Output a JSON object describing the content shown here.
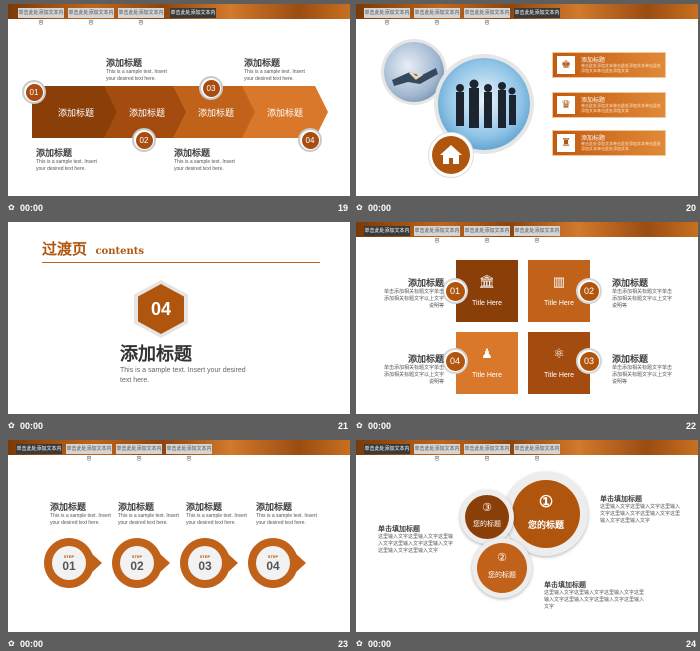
{
  "top_tabs": [
    "单击此处添加文本内容",
    "单击此处添加文本内容",
    "单击此处添加文本内容",
    "单击此处添加文本内容"
  ],
  "bottom_time": "00:00",
  "clock_icon": "clock-icon",
  "slides": {
    "s19": {
      "number": "19",
      "chevrons": [
        "添加标题",
        "添加标题",
        "添加标题",
        "添加标题"
      ],
      "markers": [
        "01",
        "02",
        "03",
        "04"
      ],
      "caption_title": "添加标题",
      "caption_text": "This is a sample text. Insert your desired text here."
    },
    "s20": {
      "number": "20",
      "boxes": [
        {
          "title": "添加标题",
          "text": "单击此处添加文本单击此处添加文本单击此处添加文本单击此处添加文本"
        },
        {
          "title": "添加标题",
          "text": "单击此处添加文本单击此处添加文本单击此处添加文本单击此处添加文本"
        },
        {
          "title": "添加标题",
          "text": "单击此处添加文本单击此处添加文本单击此处添加文本单击此处添加文本"
        }
      ]
    },
    "s21": {
      "number": "21",
      "heading": "过渡页",
      "heading_en": "contents",
      "badge": "04",
      "title": "添加标题",
      "text": "This is a sample text. Insert your desired text here."
    },
    "s22": {
      "number": "22",
      "squares": [
        "Title Here",
        "Title Here",
        "Title Here",
        "Title Here"
      ],
      "markers": [
        "01",
        "02",
        "03",
        "04"
      ],
      "side_title": "添加标题",
      "side_text": "单击添加相关标题文字单击添加相关标题文字以上文字说明等"
    },
    "s23": {
      "number": "23",
      "step_label": "STEP",
      "steps": [
        "01",
        "02",
        "03",
        "04"
      ],
      "caption_title": "添加标题",
      "caption_text": "This is a sample text. Insert your desired text here."
    },
    "s24": {
      "number": "24",
      "big_num": "①",
      "big_label": "您的标题",
      "small_nums": [
        "③",
        "②"
      ],
      "small_label": "您的标题",
      "side_title": "单击填加标题",
      "side_text": "这里输入文字这里输入文字这里输入文字这里输入文字这里输入文字这里输入文字这里输入文字"
    }
  },
  "colors": {
    "accent": "#b0550e",
    "dark_accent": "#8a3e08",
    "bar": "#5e5e5e"
  }
}
